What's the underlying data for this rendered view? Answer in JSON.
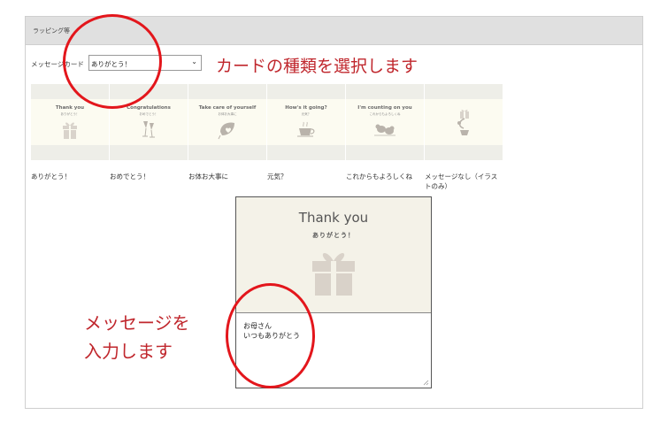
{
  "panel": {
    "title": "ラッピング等"
  },
  "card_select": {
    "label": "メッセージカード",
    "value": "ありがとう！"
  },
  "annotations": {
    "top": "カードの種類を選択します",
    "bottom_line1": "メッセージを",
    "bottom_line2": "入力します"
  },
  "cards": [
    {
      "title": "Thank you",
      "subtitle": "ありがとう！",
      "icon": "gift-icon",
      "label": "ありがとう！"
    },
    {
      "title": "Congratulations",
      "subtitle": "おめでとう！",
      "icon": "champagne-glasses-icon",
      "label": "おめでとう！"
    },
    {
      "title": "Take care of yourself",
      "subtitle": "お体お大事に",
      "icon": "leaf-heart-icon",
      "label": "お体お大事に"
    },
    {
      "title": "How's it going?",
      "subtitle": "元気？",
      "icon": "coffee-cup-icon",
      "label": "元気？"
    },
    {
      "title": "I'm counting on you",
      "subtitle": "これからもよろしくね",
      "icon": "birds-icon",
      "label": "これからもよろしくね"
    },
    {
      "title": "",
      "subtitle": "",
      "icon": "gift-vase-icon",
      "label": "メッセージなし（イラストのみ）"
    }
  ],
  "preview": {
    "heading": "Thank you",
    "subheading": "ありがとう！",
    "message": "お母さん\nいつもありがとう"
  },
  "colors": {
    "annotation": "#c0272d",
    "circle": "#e3161c",
    "card_bg": "#fcfbf1",
    "header_bg": "#e0e0e0"
  }
}
